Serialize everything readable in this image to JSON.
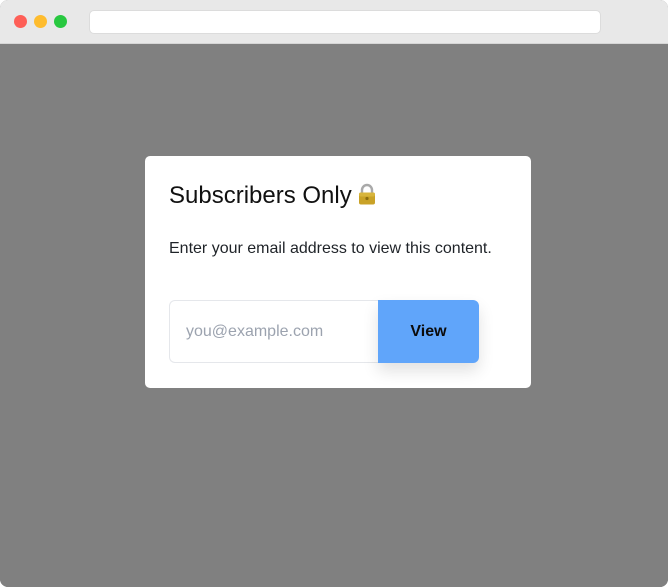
{
  "window": {
    "url": ""
  },
  "card": {
    "title": "Subscribers Only",
    "lock_icon": "lock-icon",
    "description": "Enter your email address to view this content.",
    "email_placeholder": "you@example.com",
    "email_value": "",
    "view_label": "View"
  },
  "colors": {
    "backdrop": "#808080",
    "button": "#60a5fa"
  }
}
